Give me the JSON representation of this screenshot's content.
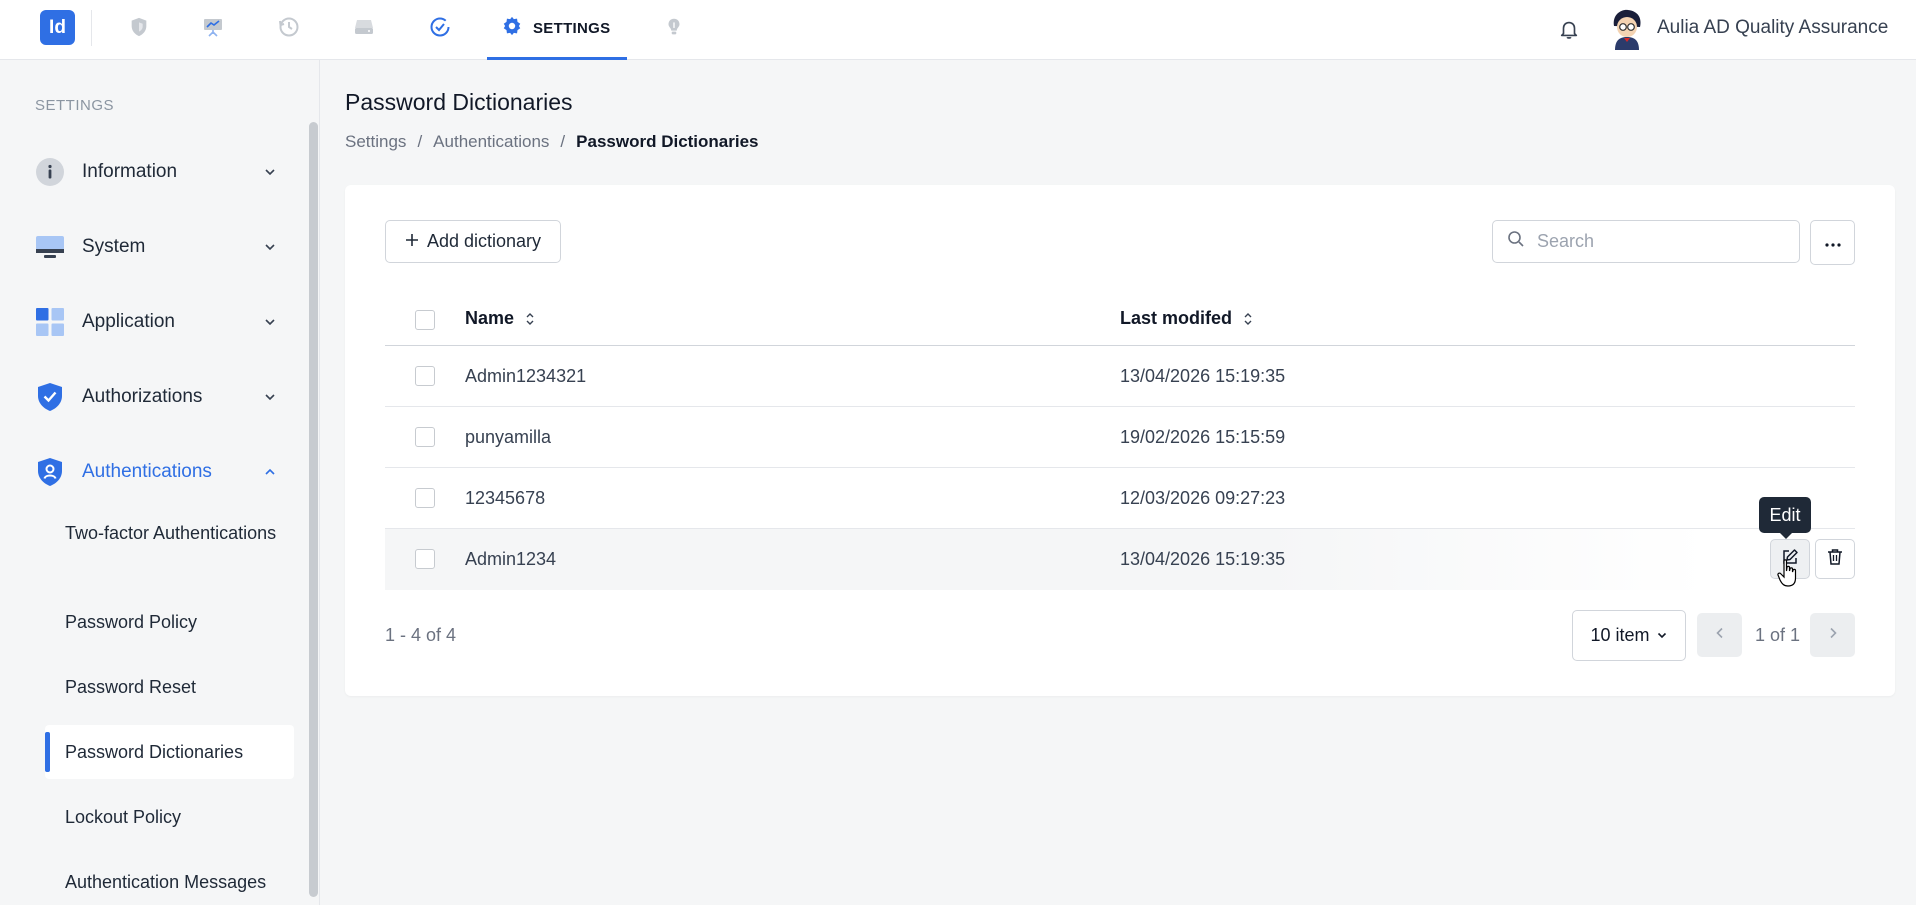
{
  "topbar": {
    "logo_text": "Id",
    "nav_icons": [
      "shield-icon",
      "presentation-icon",
      "history-icon",
      "drive-icon",
      "check-circle-icon",
      "lightbulb-icon"
    ],
    "active_tab_label": "SETTINGS",
    "user_name": "Aulia AD Quality Assurance"
  },
  "sidebar": {
    "heading": "SETTINGS",
    "items": [
      {
        "label": "Information",
        "icon": "info-icon"
      },
      {
        "label": "System",
        "icon": "monitor-icon"
      },
      {
        "label": "Application",
        "icon": "grid-icon"
      },
      {
        "label": "Authorizations",
        "icon": "shield-check-icon"
      },
      {
        "label": "Authentications",
        "icon": "shield-user-icon",
        "expanded": true
      }
    ],
    "sub_items": [
      "Two-factor Authentications",
      "Password Policy",
      "Password Reset",
      "Password Dictionaries",
      "Lockout Policy",
      "Authentication Messages"
    ],
    "active_sub_item": "Password Dictionaries"
  },
  "page": {
    "title": "Password Dictionaries",
    "breadcrumb": [
      "Settings",
      "/",
      "Authentications",
      "/",
      "Password Dictionaries"
    ]
  },
  "toolbar": {
    "add_label": "Add dictionary",
    "search_placeholder": "Search",
    "more_label": "···"
  },
  "table": {
    "headers": {
      "name": "Name",
      "modified": "Last modifed"
    },
    "rows": [
      {
        "name": "Admin1234321",
        "modified": "13/04/2026 15:19:35"
      },
      {
        "name": "punyamilla",
        "modified": "19/02/2026 15:15:59"
      },
      {
        "name": "12345678",
        "modified": "12/03/2026 09:27:23"
      },
      {
        "name": "Admin1234",
        "modified": "13/04/2026 15:19:35"
      }
    ],
    "tooltip": "Edit"
  },
  "pagination": {
    "range": "1 - 4 of 4",
    "page_size": "10 item",
    "page": "1 of 1"
  },
  "colors": {
    "accent": "#2f6fe4",
    "text": "#1f2937",
    "muted": "#6b7280",
    "background": "#f5f6f7"
  }
}
